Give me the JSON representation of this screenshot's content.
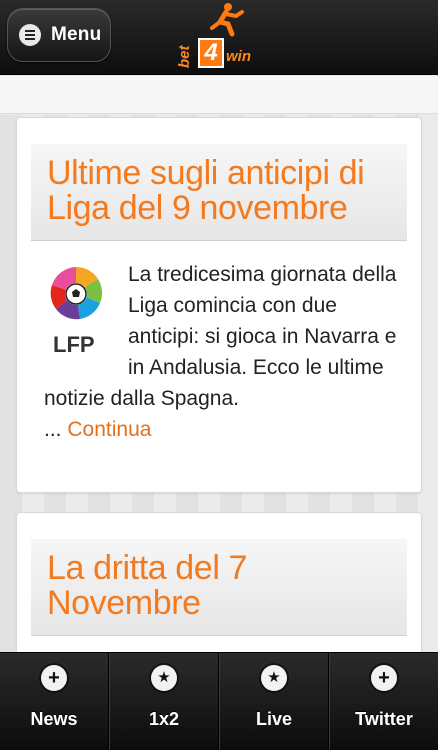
{
  "header": {
    "menu_label": "Menu",
    "logo": {
      "bet": "bet",
      "four": "4",
      "win": "win"
    }
  },
  "articles": [
    {
      "title": "Ultime sugli anticipi di Liga del 9 novembre",
      "logo_text": "LFP",
      "excerpt": "La tredicesima giornata della Liga comincia con due anticipi: si gioca in Navarra e in Andalusia. Ecco le ultime notizie dalla Spagna.",
      "ellipsis": "...",
      "read_more": "Continua"
    },
    {
      "title": "La dritta del 7 Novembre"
    }
  ],
  "tabbar": {
    "tabs": [
      {
        "label": "News",
        "icon": "plus-icon"
      },
      {
        "label": "1x2",
        "icon": "star-icon"
      },
      {
        "label": "Live",
        "icon": "star-icon"
      },
      {
        "label": "Twitter",
        "icon": "plus-icon"
      }
    ]
  },
  "colors": {
    "accent": "#f47a1f",
    "header_bg": "#1a1a1a"
  }
}
